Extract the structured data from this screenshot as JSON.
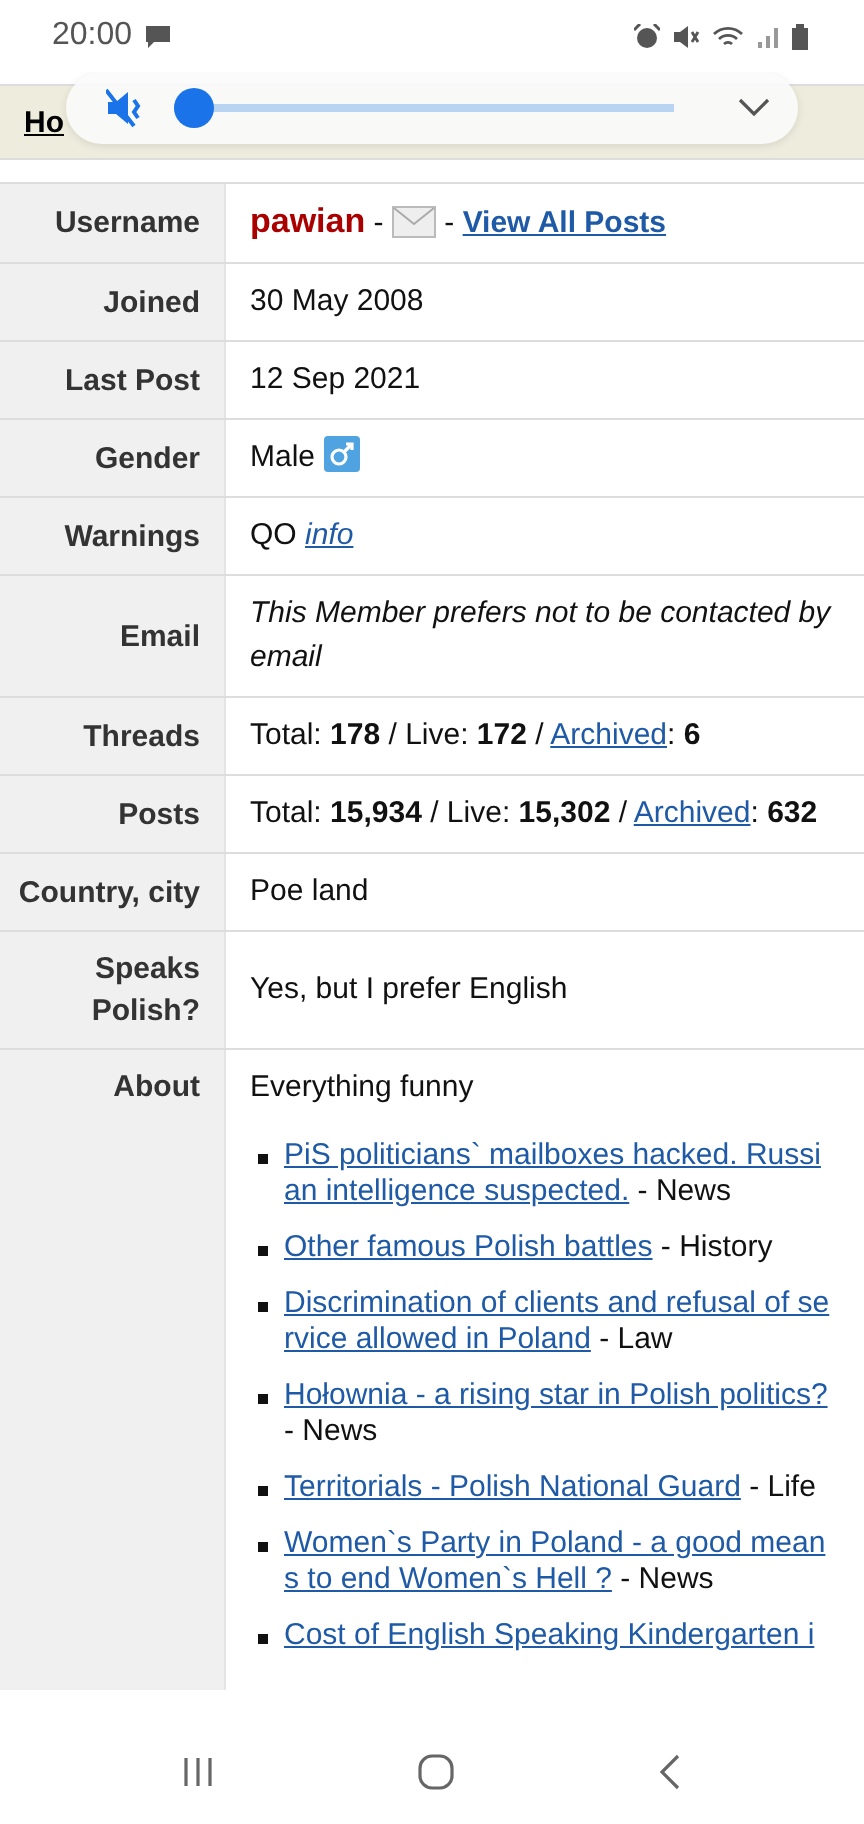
{
  "status_bar": {
    "time": "20:00"
  },
  "breadcrumb": {
    "items": [
      "Ho"
    ]
  },
  "volume_popup": {
    "muted": true,
    "level": 0.0
  },
  "profile": [
    {
      "label": "Username",
      "value": [
        {
          "kind": "user",
          "text": "pawian"
        },
        {
          "kind": "text",
          "text": " - "
        },
        {
          "kind": "envelope"
        },
        {
          "kind": "text",
          "text": " - "
        },
        {
          "kind": "boldlink",
          "text": "View All Posts"
        }
      ]
    },
    {
      "label": "Joined",
      "value": [
        {
          "kind": "text",
          "text": "30 May 2008"
        }
      ]
    },
    {
      "label": "Last Post",
      "value": [
        {
          "kind": "text",
          "text": "12 Sep 2021"
        }
      ]
    },
    {
      "label": "Gender",
      "value": [
        {
          "kind": "text",
          "text": "Male "
        },
        {
          "kind": "male-sign"
        }
      ]
    },
    {
      "label": "Warnings",
      "value": [
        {
          "kind": "text",
          "text": "QO "
        },
        {
          "kind": "italiclink",
          "text": "info"
        }
      ]
    },
    {
      "label": "Email",
      "value": [
        {
          "kind": "italic",
          "text": "This Member prefers not to be contacted by email"
        }
      ]
    },
    {
      "label": "Threads",
      "value": [
        {
          "kind": "text",
          "text": "Total: **178** / Live: **172** / "
        },
        {
          "kind": "link",
          "text": "Archived"
        },
        {
          "kind": "text",
          "text": ": **6**"
        }
      ]
    },
    {
      "label": "Posts",
      "value": [
        {
          "kind": "text",
          "text": "Total: **15,934** / Live: **15,302** / "
        },
        {
          "kind": "link",
          "text": "Archived"
        },
        {
          "kind": "text",
          "text": ": **632**"
        }
      ]
    },
    {
      "label": "Country, city",
      "value": [
        {
          "kind": "text",
          "text": "Poe land"
        }
      ]
    },
    {
      "label": "Speaks Polish?",
      "value": [
        {
          "kind": "text",
          "text": "Yes, but I prefer English"
        }
      ]
    },
    {
      "label": "About",
      "value": [
        {
          "kind": "text",
          "text": "Everything funny"
        }
      ]
    }
  ],
  "threads": [
    {
      "title": "PiS politicians` mailboxes hacked. Russian intelligence suspected.",
      "category": " - News"
    },
    {
      "title": "Other famous Polish battles",
      "category": " - History"
    },
    {
      "title": "Discrimination of clients and refusal of service allowed in Poland",
      "category": " - Law"
    },
    {
      "title": "Hołownia - a rising star in Polish politics?",
      "category": " - News"
    },
    {
      "title": "Territorials - Polish National Guard",
      "category": " - Life"
    },
    {
      "title": "Women`s Party in Poland - a good means to end Women`s Hell ?",
      "category": " - News"
    },
    {
      "title": "Cost of English Speaking Kindergarten i"
    }
  ]
}
